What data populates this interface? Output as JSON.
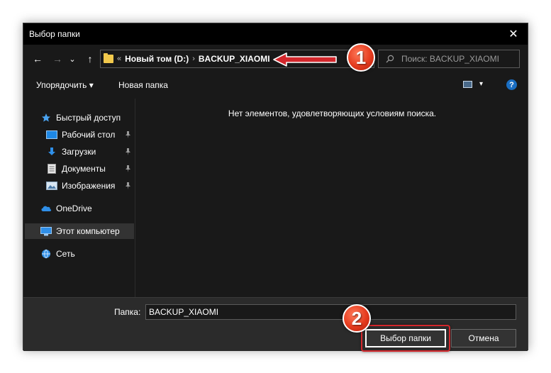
{
  "window": {
    "title": "Выбор папки",
    "close_glyph": "✕"
  },
  "nav": {
    "back_glyph": "←",
    "forward_glyph": "→",
    "recent_glyph": "⌄",
    "up_glyph": "↑"
  },
  "address": {
    "overflow_glyph": "«",
    "separator": "›",
    "crumbs": [
      "Новый том (D:)",
      "BACKUP_XIAOMI"
    ]
  },
  "search": {
    "placeholder": "Поиск: BACKUP_XIAOMI",
    "icon": "search-icon"
  },
  "toolbar": {
    "organize_label": "Упорядочить ▾",
    "new_folder_label": "Новая папка",
    "view_dropdown_glyph": "▾",
    "help_glyph": "?"
  },
  "sidebar": {
    "quick_access": "Быстрый доступ",
    "items": [
      {
        "label": "Рабочий стол",
        "icon": "desktop-icon"
      },
      {
        "label": "Загрузки",
        "icon": "download-icon"
      },
      {
        "label": "Документы",
        "icon": "documents-icon"
      },
      {
        "label": "Изображения",
        "icon": "pictures-icon"
      }
    ],
    "pin_glyph": "📌",
    "onedrive": "OneDrive",
    "this_pc": "Этот компьютер",
    "network": "Сеть"
  },
  "content": {
    "empty_message": "Нет элементов, удовлетворяющих условиям поиска."
  },
  "footer": {
    "folder_label": "Папка:",
    "folder_value": "BACKUP_XIAOMI",
    "select_label": "Выбор папки",
    "cancel_label": "Отмена"
  },
  "annotations": {
    "marker_1": "1",
    "marker_2": "2",
    "arrow_color": "#d3272c"
  }
}
